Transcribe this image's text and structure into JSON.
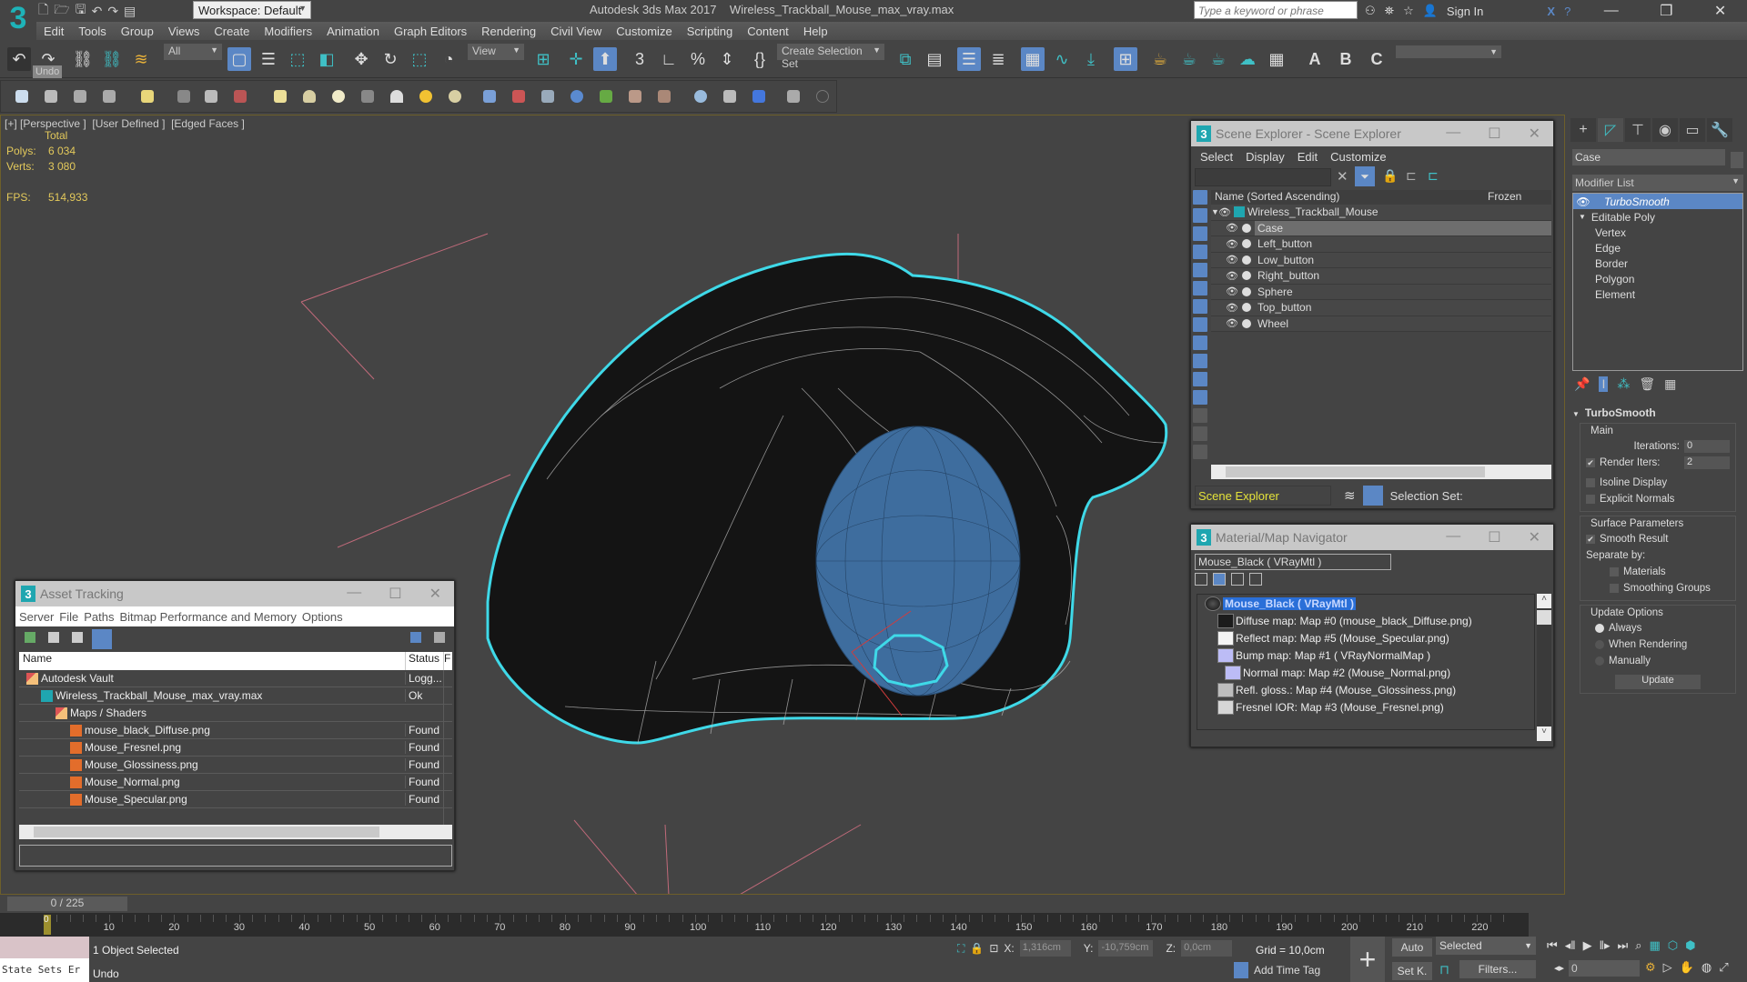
{
  "app": {
    "title": "Autodesk 3ds Max 2017    Wireless_Trackball_Mouse_max_vray.max",
    "logo_text": "3",
    "workspace": "Workspace: Default",
    "search_placeholder": "Type a keyword or phrase",
    "sign_in": "Sign In",
    "accent": "#1fa6b0",
    "selection_highlight": "#5b87c5",
    "outline_color": "#3fd9e8"
  },
  "menu": [
    "Edit",
    "Tools",
    "Group",
    "Views",
    "Create",
    "Modifiers",
    "Animation",
    "Graph Editors",
    "Rendering",
    "Civil View",
    "Customize",
    "Scripting",
    "Content",
    "Help"
  ],
  "toolbar": {
    "selection_filter": "All",
    "reference_coord": "View",
    "create_selection_set": "Create Selection Set",
    "undo_tooltip": "Undo",
    "render_labels": [
      "A",
      "B",
      "C"
    ]
  },
  "viewport": {
    "label": "[+] [Perspective ]  [User Defined ]  [Edged Faces ]",
    "stats_header": "Total",
    "stats": [
      {
        "label": "Polys:",
        "value": "6 034"
      },
      {
        "label": "Verts:",
        "value": "3 080"
      }
    ],
    "fps_label": "FPS:",
    "fps_value": "514,933"
  },
  "scene_explorer": {
    "title": "Scene Explorer - Scene Explorer",
    "menu": [
      "Select",
      "Display",
      "Edit",
      "Customize"
    ],
    "col_name": "Name (Sorted Ascending)",
    "col_frozen": "Frozen",
    "root": "Wireless_Trackball_Mouse",
    "items": [
      {
        "name": "Case",
        "selected": true
      },
      {
        "name": "Left_button",
        "selected": false
      },
      {
        "name": "Low_button",
        "selected": false
      },
      {
        "name": "Right_button",
        "selected": false
      },
      {
        "name": "Sphere",
        "selected": false
      },
      {
        "name": "Top_button",
        "selected": false
      },
      {
        "name": "Wheel",
        "selected": false
      }
    ],
    "footer_name": "Scene Explorer",
    "selection_set_label": "Selection Set:"
  },
  "material_navigator": {
    "title": "Material/Map Navigator",
    "field": "Mouse_Black  ( VRayMtl )",
    "root": "Mouse_Black  ( VRayMtl )",
    "maps": [
      {
        "label": "Diffuse map: Map #0 (mouse_black_Diffuse.png)",
        "swatch": "#1c1c1c",
        "indent": 0
      },
      {
        "label": "Reflect map: Map #5 (Mouse_Specular.png)",
        "swatch": "#f4f4f4",
        "indent": 0
      },
      {
        "label": "Bump map: Map #1  ( VRayNormalMap )",
        "swatch": "#bcbcf6",
        "indent": 0
      },
      {
        "label": "Normal map: Map #2 (Mouse_Normal.png)",
        "swatch": "#bcbcf6",
        "indent": 1
      },
      {
        "label": "Refl. gloss.: Map #4 (Mouse_Glossiness.png)",
        "swatch": "#bdbdbd",
        "indent": 0
      },
      {
        "label": "Fresnel IOR: Map #3 (Mouse_Fresnel.png)",
        "swatch": "#d6d6d6",
        "indent": 0
      }
    ]
  },
  "command_panel": {
    "object_name": "Case",
    "modifier_list": "Modifier List",
    "stack": [
      {
        "name": "TurboSmooth",
        "type": "modifier",
        "active": true
      },
      {
        "name": "Editable Poly",
        "type": "base",
        "active": false
      }
    ],
    "sub_objects": [
      "Vertex",
      "Edge",
      "Border",
      "Polygon",
      "Element"
    ],
    "turbosmooth": {
      "title": "TurboSmooth",
      "main_label": "Main",
      "iterations_label": "Iterations:",
      "iterations": "0",
      "render_iters_label": "Render Iters:",
      "render_iters": "2",
      "render_iters_checked": true,
      "isoline_label": "Isoline Display",
      "explicit_label": "Explicit Normals",
      "surface_label": "Surface Parameters",
      "smooth_result_label": "Smooth Result",
      "separate_by_label": "Separate by:",
      "materials_label": "Materials",
      "smoothing_groups_label": "Smoothing Groups",
      "update_options_label": "Update Options",
      "update_options": [
        {
          "label": "Always",
          "selected": true
        },
        {
          "label": "When Rendering",
          "selected": false
        },
        {
          "label": "Manually",
          "selected": false
        }
      ],
      "update_button": "Update"
    }
  },
  "asset_tracking": {
    "title": "Asset Tracking",
    "menu": [
      "Server",
      "File",
      "Paths",
      "Bitmap Performance and Memory",
      "Options"
    ],
    "col_name": "Name",
    "col_status": "Status",
    "col_extra": "F",
    "rows": [
      {
        "name": "Autodesk Vault",
        "status": "Logg...",
        "indent": 0,
        "icon": "vault"
      },
      {
        "name": "Wireless_Trackball_Mouse_max_vray.max",
        "status": "Ok",
        "indent": 1,
        "icon": "max"
      },
      {
        "name": "Maps / Shaders",
        "status": "",
        "indent": 2,
        "icon": "vault"
      },
      {
        "name": "mouse_black_Diffuse.png",
        "status": "Found",
        "indent": 3,
        "icon": "png"
      },
      {
        "name": "Mouse_Fresnel.png",
        "status": "Found",
        "indent": 3,
        "icon": "png"
      },
      {
        "name": "Mouse_Glossiness.png",
        "status": "Found",
        "indent": 3,
        "icon": "png"
      },
      {
        "name": "Mouse_Normal.png",
        "status": "Found",
        "indent": 3,
        "icon": "png"
      },
      {
        "name": "Mouse_Specular.png",
        "status": "Found",
        "indent": 3,
        "icon": "png"
      }
    ]
  },
  "timeline": {
    "slider": "0 / 225",
    "current_frame": "0",
    "ticks": [
      "10",
      "20",
      "30",
      "40",
      "50",
      "60",
      "70",
      "80",
      "90",
      "100",
      "110",
      "120",
      "130",
      "140",
      "150",
      "160",
      "170",
      "180",
      "190",
      "200",
      "210",
      "220"
    ]
  },
  "status_bar": {
    "maxscript": "State Sets Er",
    "status": "1 Object Selected",
    "prompt": "Undo",
    "x_label": "X:",
    "x": "1,316cm",
    "y_label": "Y:",
    "y": "-10,759cm",
    "z_label": "Z:",
    "z": "0,0cm",
    "grid": "Grid = 10,0cm",
    "add_time_tag": "Add Time Tag",
    "auto_key": "Auto",
    "set_key": "Set K.",
    "key_filter": "Selected",
    "filters": "Filters...",
    "frame": "0"
  }
}
